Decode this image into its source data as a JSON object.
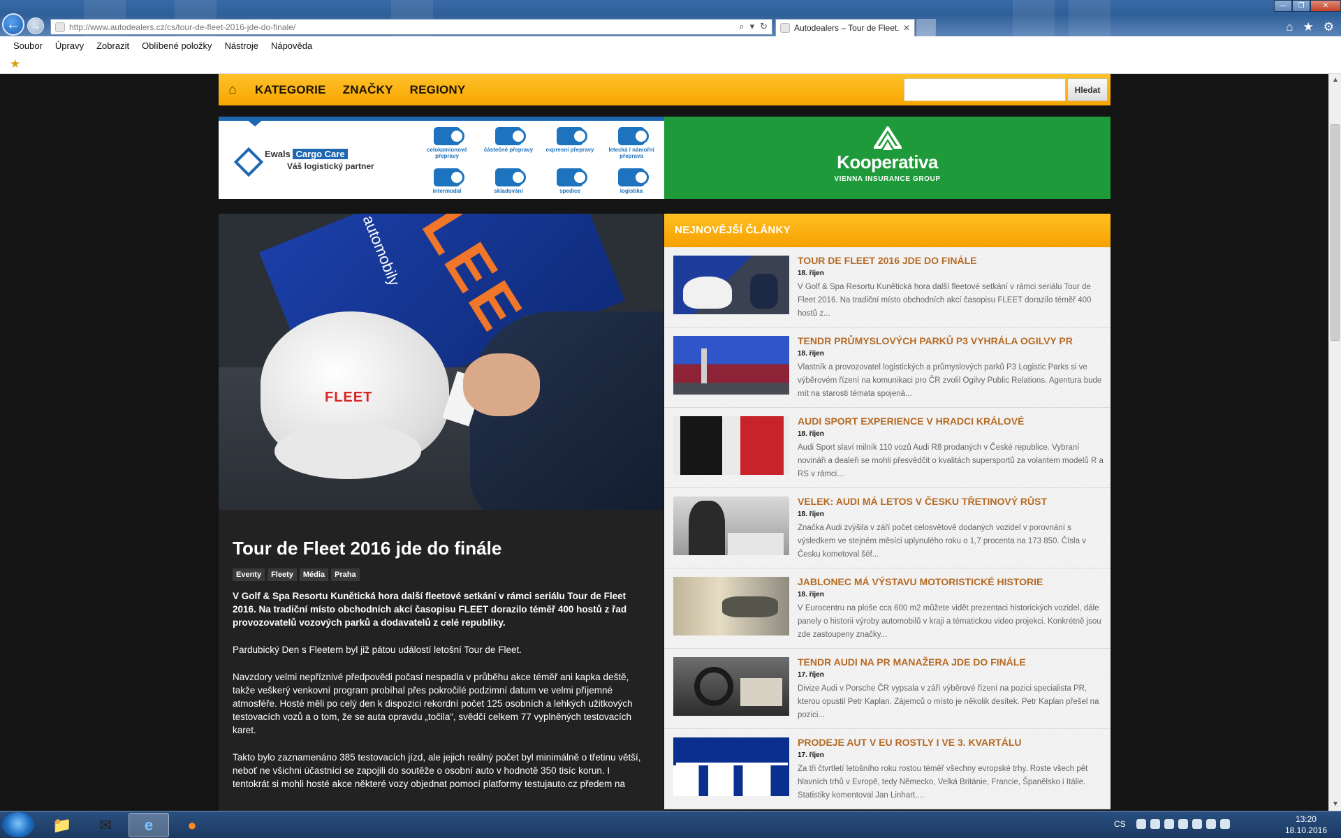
{
  "browser": {
    "url_host": "http://www.autodealers.cz",
    "url_path": "/cs/tour-de-fleet-2016-jde-do-finale/",
    "tab_title": "Autodealers – Tour de Fleet...",
    "tab_close": "✕",
    "menu": [
      "Soubor",
      "Úpravy",
      "Zobrazit",
      "Oblíbené položky",
      "Nástroje",
      "Nápověda"
    ]
  },
  "site_nav": {
    "links": [
      "KATEGORIE",
      "ZNAČKY",
      "REGIONY"
    ],
    "search_button": "Hledat",
    "search_value": ""
  },
  "banners": {
    "ewals": {
      "brand": "Ewals",
      "brand_highlight": "Cargo Care",
      "tagline": "Váš logistický partner",
      "services": [
        "celokamionové přepravy",
        "částečné přepravy",
        "expresní přepravy",
        "letecká / námořní přeprava",
        "intermodal",
        "skladování",
        "spedice",
        "logistika"
      ]
    },
    "kooperativa": {
      "name": "Kooperativa",
      "sub": "VIENNA INSURANCE GROUP"
    }
  },
  "hero": {
    "board_text": "FLEET",
    "board_subtext": "mní automobily",
    "cap_text": "FLEET"
  },
  "article": {
    "title": "Tour de Fleet 2016 jde do finále",
    "tags": [
      "Eventy",
      "Fleety",
      "Média",
      "Praha"
    ],
    "lead": "V Golf & Spa Resortu Kunětická hora další fleetové setkání v rámci seriálu Tour de Fleet 2016. Na tradiční místo obchodních akcí časopisu FLEET dorazilo téměř 400 hostů z řad provozovatelů vozových parků a dodavatelů z celé republiky.",
    "p1": "Pardubický Den s Fleetem byl již pátou událostí letošní Tour de Fleet.",
    "p2": "Navzdory velmi nepříznivé předpovědi počasí nespadla v průběhu akce téměř ani kapka deště, takže veškerý venkovní program probíhal přes pokročilé podzimní datum ve velmi příjemné atmosféře. Hosté měli po celý den k dispozici rekordní počet 125 osobních a lehkých užitkových testovacích vozů a o tom, že se auta opravdu „točila“, svědčí celkem 77 vyplněných testovacích karet.",
    "p3": "Takto bylo zaznamenáno 385 testovacích jízd, ale jejich reálný počet byl minimálně o třetinu větší, neboť ne všichni účastníci se zapojili do soutěže o osobní auto v hodnotě 350 tisíc korun. I tentokrát si mohli hosté akce některé vozy objednat pomocí platformy testujauto.cz předem na"
  },
  "sidebar": {
    "heading": "NEJNOVĚJŠÍ ČLÁNKY",
    "items": [
      {
        "title": "TOUR DE FLEET 2016 JDE DO FINÁLE",
        "date": "18. říjen",
        "excerpt": "V Golf & Spa Resortu Kunětická hora další fleetové setkání v rámci seriálu Tour de Fleet 2016. Na tradiční místo obchodních akcí časopisu FLEET dorazilo téměř 400 hostů z..."
      },
      {
        "title": "TENDR PRŮMYSLOVÝCH PARKŮ P3 VYHRÁLA OGILVY PR",
        "date": "18. říjen",
        "excerpt": "Vlastník a provozovatel logistických a průmyslových parků P3 Logistic Parks si ve výběrovém řízení na komunikaci pro ČR zvolil Ogilvy Public Relations. Agentura bude mít na starosti témata spojená..."
      },
      {
        "title": "AUDI SPORT EXPERIENCE V HRADCI KRÁLOVÉ",
        "date": "18. říjen",
        "excerpt": "Audi Sport slaví milník 110 vozů Audi R8 prodaných v České republice. Vybraní novináři  a dealeři se mohli přesvědčit o kvalitách supersportů za volantem modelů R a RS v rámci..."
      },
      {
        "title": "VELEK: AUDI MÁ LETOS V ČESKU TŘETINOVÝ RŮST",
        "date": "18. říjen",
        "excerpt": "Značka Audi zvýšila v září počet celosvětově dodaných vozidel v porovnání s výsledkem ve stejném měsíci uplynulého roku o 1,7 procenta na 173 850. Čísla v Česku kometoval šéf..."
      },
      {
        "title": "JABLONEC MÁ VÝSTAVU MOTORISTICKÉ HISTORIE",
        "date": "18. říjen",
        "excerpt": "V Eurocentru na ploše cca 600 m2 můžete vidět prezentaci historických vozidel, dále panely o historii výroby automobilů v kraji a tématickou video projekci. Konkrétně jsou zde zastoupeny značky..."
      },
      {
        "title": "TENDR AUDI NA PR MANAŽERA JDE DO FINÁLE",
        "date": "17. říjen",
        "excerpt": "Divize Audi v Porsche ČR vypsala v září výběrové řízení na pozici specialista PR, kterou opustil Petr Kaplan. Zájemců o místo je několik desítek. Petr Kaplan přešel na pozici..."
      },
      {
        "title": "PRODEJE AUT V EU ROSTLY I VE 3. KVARTÁLU",
        "date": "17. říjen",
        "excerpt": "Za tři čtvrtletí letošního roku rostou téměř všechny evropské trhy. Roste všech pět hlavních trhů v Evropě, tedy Německo, Velká Británie, Francie, Španělsko i Itálie. Statistiky komentoval Jan Linhart,..."
      }
    ]
  },
  "taskbar": {
    "lang": "CS",
    "time": "13:20",
    "date": "18.10.2016"
  }
}
